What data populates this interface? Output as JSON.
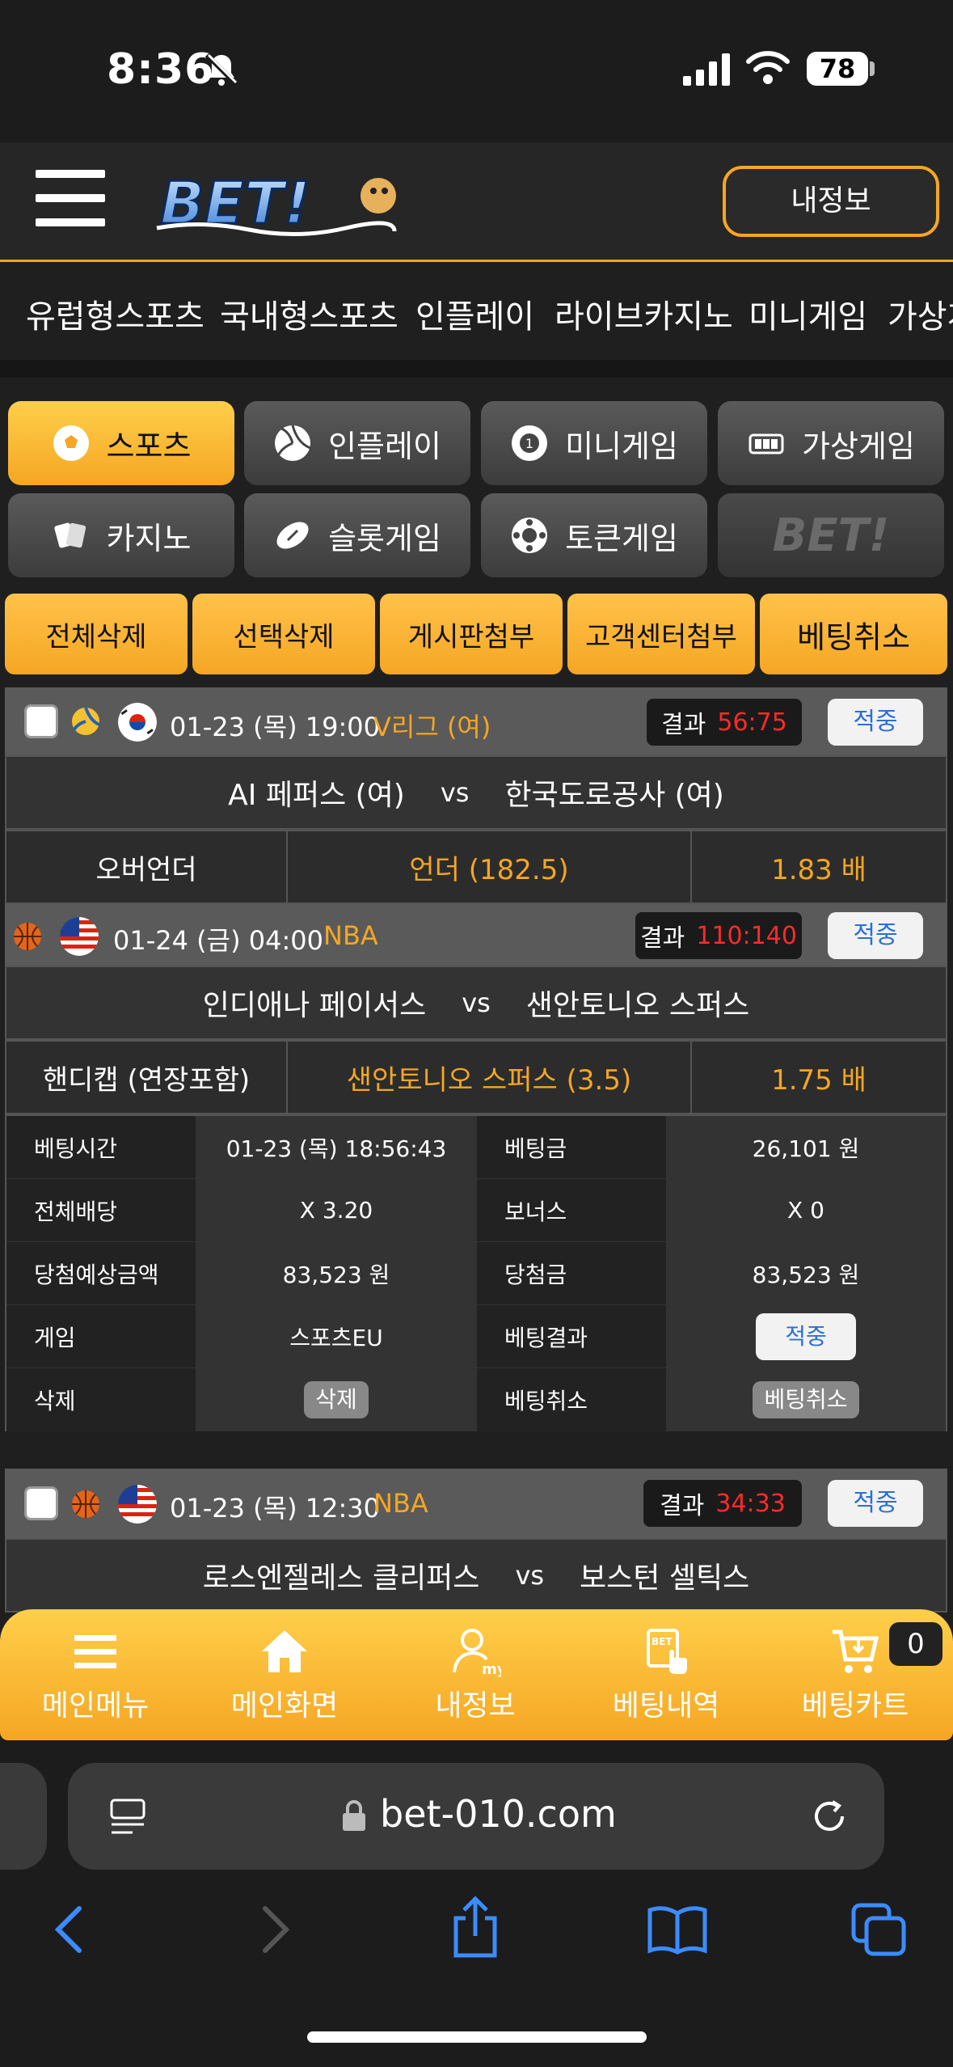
{
  "status": {
    "time": "8:36",
    "battery": "78"
  },
  "header": {
    "logo_text": "BET!",
    "myinfo_label": "내정보"
  },
  "nav": {
    "items": [
      "유럽형스포츠",
      "국내형스포츠",
      "인플레이",
      "라이브카지노",
      "미니게임",
      "가상게"
    ]
  },
  "categories": [
    {
      "label": "스포츠",
      "icon": "soccer-ball-icon",
      "active": true
    },
    {
      "label": "인플레이",
      "icon": "volleyball-icon"
    },
    {
      "label": "미니게임",
      "icon": "mini-game-icon"
    },
    {
      "label": "가상게임",
      "icon": "virtual-game-icon"
    },
    {
      "label": "카지노",
      "icon": "cards-icon"
    },
    {
      "label": "슬롯게임",
      "icon": "football-icon"
    },
    {
      "label": "토큰게임",
      "icon": "token-icon"
    },
    {
      "label": "BET!",
      "icon": "bet-logo"
    }
  ],
  "actions": [
    "전체삭제",
    "선택삭제",
    "게시판첨부",
    "고객센터첨부",
    "베팅취소"
  ],
  "bets": [
    {
      "datetime": "01-23 (목) 19:00",
      "league": "V리그 (여)",
      "result_label": "결과",
      "score": "56:75",
      "status": "적중",
      "home": "AI 페퍼스 (여)",
      "vs": "vs",
      "away": "한국도로공사 (여)",
      "market": "오버언더",
      "pick": "언더 (182.5)",
      "odds": "1.83 배"
    },
    {
      "datetime": "01-24 (금) 04:00",
      "league": "NBA",
      "result_label": "결과",
      "score": "110:140",
      "status": "적중",
      "home": "인디애나 페이서스",
      "vs": "vs",
      "away": "샌안토니오 스퍼스",
      "market": "핸디캡 (연장포함)",
      "pick": "샌안토니오 스퍼스 (3.5)",
      "odds": "1.75 배"
    },
    {
      "datetime": "01-23 (목) 12:30",
      "league": "NBA",
      "result_label": "결과",
      "score": "34:33",
      "status": "적중",
      "home": "로스엔젤레스 클리퍼스",
      "vs": "vs",
      "away": "보스턴 셀틱스"
    }
  ],
  "details": {
    "bet_time_label": "베팅시간",
    "bet_time": "01-23 (목) 18:56:43",
    "bet_amount_label": "베팅금",
    "bet_amount": "26,101 원",
    "total_odds_label": "전체배당",
    "total_odds": "X 3.20",
    "bonus_label": "보너스",
    "bonus": "X 0",
    "expected_label": "당첨예상금액",
    "expected": "83,523 원",
    "win_label": "당첨금",
    "win": "83,523 원",
    "game_label": "게임",
    "game": "스포츠EU",
    "result_label": "베팅결과",
    "result": "적중",
    "delete_label": "삭제",
    "delete_btn": "삭제",
    "cancel_label": "베팅취소",
    "cancel_btn": "베팅취소"
  },
  "bottom_nav": [
    "메인메뉴",
    "메인화면",
    "내정보",
    "베팅내역",
    "베팅카트"
  ],
  "cart_count": "0",
  "browser": {
    "url": "bet-010.com"
  }
}
